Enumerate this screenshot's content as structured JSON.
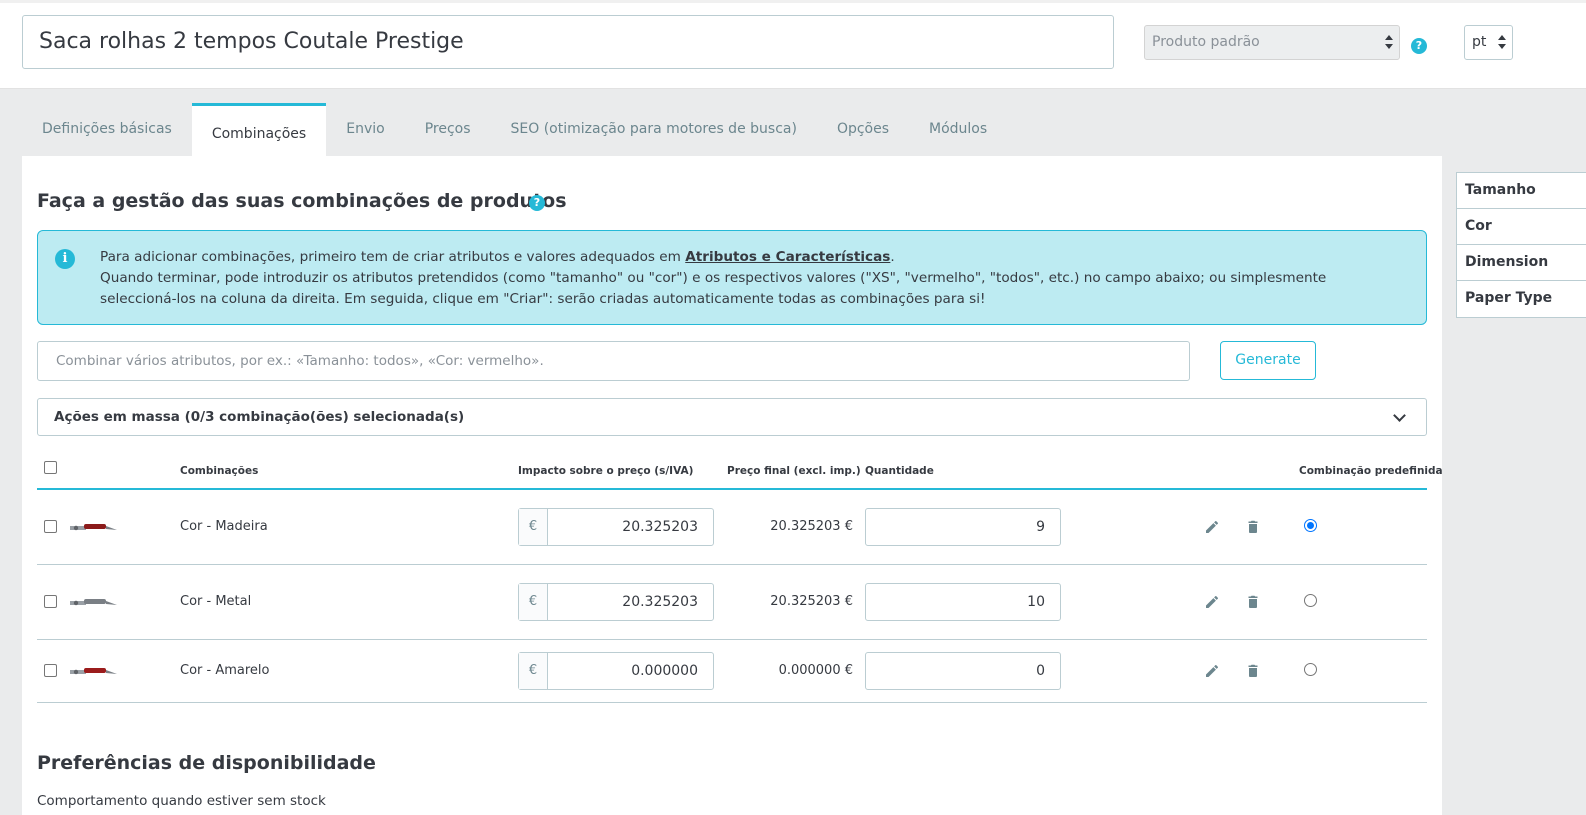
{
  "header": {
    "product_name": "Saca rolhas 2 tempos Coutale Prestige",
    "product_type": "Produto padrão",
    "help_icon": "help-icon",
    "language": "pt"
  },
  "tabs": [
    {
      "label": "Definições básicas"
    },
    {
      "label": "Combinações"
    },
    {
      "label": "Envio"
    },
    {
      "label": "Preços"
    },
    {
      "label": "SEO (otimização para motores de busca)"
    },
    {
      "label": "Opções"
    },
    {
      "label": "Módulos"
    }
  ],
  "combinations": {
    "title": "Faça a gestão das suas combinações de produtos",
    "info": {
      "line1_prefix": "Para adicionar combinações, primeiro tem de criar atributos e valores adequados em ",
      "line1_link": "Atributos e Características",
      "line1_suffix": ".",
      "line2": "Quando terminar, pode introduzir os atributos pretendidos (como \"tamanho\" ou \"cor\") e os respectivos valores (\"XS\", \"vermelho\", \"todos\", etc.) no campo abaixo; ou simplesmente seleccioná-los na coluna da direita. Em seguida, clique em \"Criar\": serão criadas automaticamente todas as combinações para si!"
    },
    "combine_placeholder": "Combinar vários atributos, por ex.: «Tamanho: todos», «Cor: vermelho».",
    "generate_label": "Generate",
    "bulk_label": "Ações em massa (0/3 combinação(ões) selecionada(s)",
    "table": {
      "headers": {
        "combination": "Combinações",
        "impact": "Impacto sobre o preço (s/IVA)",
        "final_price": "Preço final (excl. imp.)",
        "quantity": "Quantidade",
        "default": "Combinação predefinida"
      },
      "rows": [
        {
          "name": "Cor - Madeira",
          "currency": "€",
          "impact": "20.325203",
          "final": "20.325203 €",
          "quantity": "9",
          "is_default": true,
          "thumb_color": "#8b1a1a"
        },
        {
          "name": "Cor - Metal",
          "currency": "€",
          "impact": "20.325203",
          "final": "20.325203 €",
          "quantity": "10",
          "is_default": false,
          "thumb_color": "#7a7f85"
        },
        {
          "name": "Cor - Amarelo",
          "currency": "€",
          "impact": "0.000000",
          "final": "0.000000 €",
          "quantity": "0",
          "is_default": false,
          "thumb_color": "#9b1c1c"
        }
      ]
    }
  },
  "availability": {
    "title": "Preferências de disponibilidade",
    "behavior_label": "Comportamento quando estiver sem stock"
  },
  "attributes": [
    {
      "label": "Tamanho"
    },
    {
      "label": "Cor"
    },
    {
      "label": "Dimension"
    },
    {
      "label": "Paper Type"
    }
  ],
  "colors": {
    "accent": "#25b9d7",
    "info_bg": "#bdebf2",
    "text": "#363a41"
  }
}
